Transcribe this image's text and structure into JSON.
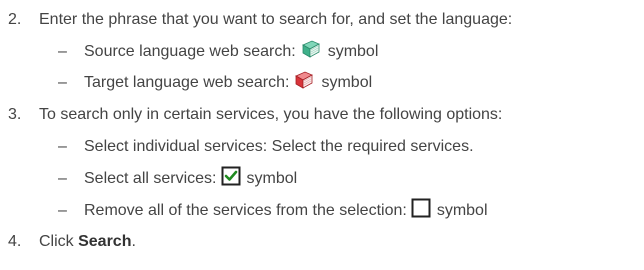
{
  "steps": [
    {
      "number": "2.",
      "text": "Enter the phrase that you want to search for, and set the language:",
      "bullets": [
        {
          "dash": "–",
          "text": "Source language web search:",
          "icon": "source-language-book-icon",
          "suffix": "symbol"
        },
        {
          "dash": "–",
          "text": "Target language web search:",
          "icon": "target-language-book-icon",
          "suffix": "symbol"
        }
      ]
    },
    {
      "number": "3.",
      "text": "To search only in certain services, you have the following options:",
      "bullets": [
        {
          "dash": "–",
          "text": "Select individual services: Select the required services."
        },
        {
          "dash": "–",
          "text": "Select all services:",
          "icon": "checked-checkbox-icon",
          "suffix": "symbol"
        },
        {
          "dash": "–",
          "text": "Remove all of the services from the selection:",
          "icon": "empty-checkbox-icon",
          "suffix": "symbol"
        }
      ]
    },
    {
      "number": "4.",
      "text_before": "Click ",
      "bold": "Search",
      "text_after": "."
    }
  ],
  "colors": {
    "text": "#444444",
    "check_green": "#1f8a1f",
    "book_green": "#3fb08a",
    "book_red": "#d8343a"
  }
}
